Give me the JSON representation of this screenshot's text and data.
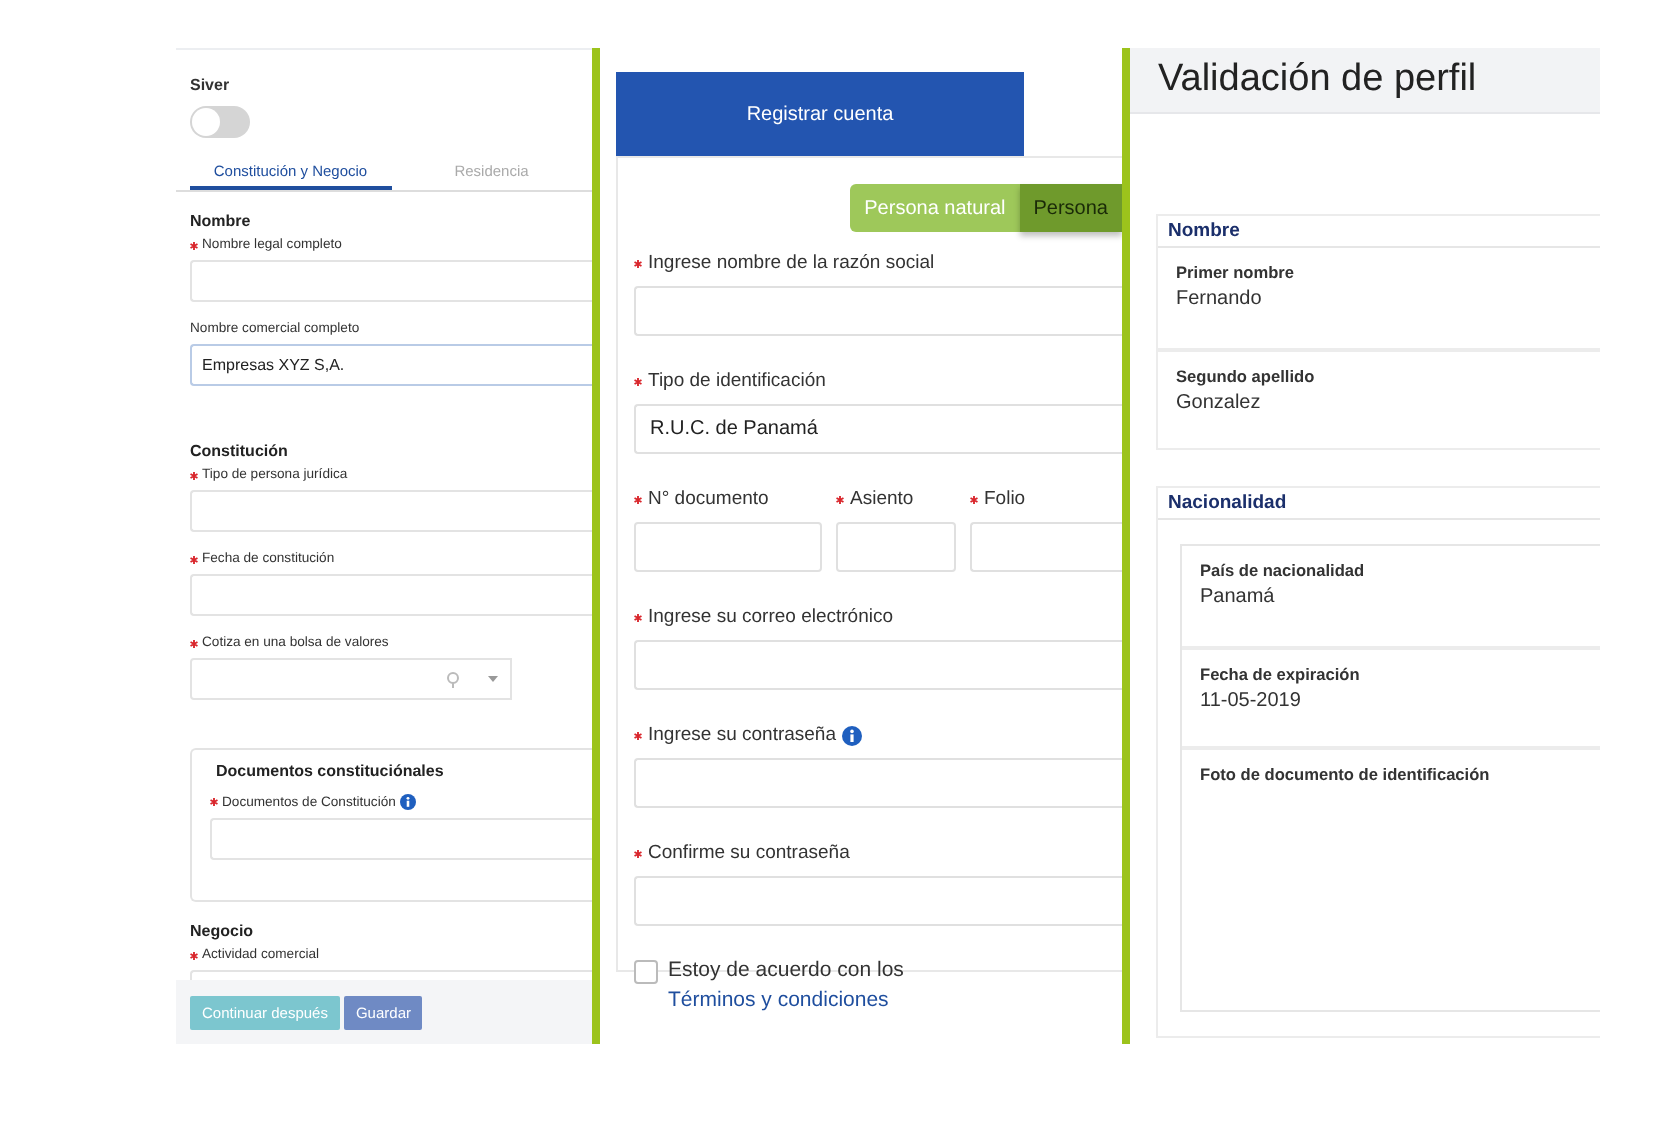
{
  "company_form": {
    "toggle": {
      "label": "Siver",
      "on": false
    },
    "tabs": [
      {
        "label": "Constitución y Negocio",
        "selected": true
      },
      {
        "label": "Residencia",
        "selected": false
      }
    ],
    "sections": [
      {
        "kind": "plain",
        "title": "Nombre",
        "fields": [
          {
            "kind": "text",
            "label": "Nombre legal completo",
            "required": true
          },
          {
            "kind": "text",
            "label": "Nombre comercial completo",
            "required": false,
            "value": "Empresas XYZ S,A."
          }
        ]
      },
      {
        "kind": "plain",
        "title": "Constitución",
        "fields": [
          {
            "kind": "text",
            "label": "Tipo de persona jurídica",
            "required": true
          },
          {
            "kind": "text",
            "label": "Fecha de constitución",
            "required": true
          },
          {
            "kind": "select",
            "label": "Cotiza en una bolsa de valores",
            "required": true
          }
        ]
      },
      {
        "kind": "fieldset",
        "title": "Documentos constituciónales",
        "fields": [
          {
            "kind": "text",
            "label": "Documentos de Constitución",
            "required": true,
            "info": true
          }
        ]
      },
      {
        "kind": "plain",
        "title": "Negocio",
        "fields": [
          {
            "kind": "text",
            "label": "Actividad comercial",
            "required": true
          }
        ]
      }
    ],
    "buttons": [
      {
        "label": "Continuar después",
        "kind": "secondary"
      },
      {
        "label": "Guardar",
        "kind": "primary"
      }
    ]
  },
  "register_form": {
    "title": "Registrar cuenta",
    "person_types": [
      {
        "label": "Persona natural",
        "selected": false
      },
      {
        "label": "Persona",
        "selected": true
      }
    ],
    "rows": [
      [
        {
          "label": "Ingrese nombre de la razón social",
          "required": true
        }
      ],
      [
        {
          "label": "Tipo de identificación",
          "required": true,
          "value": "R.U.C. de Panamá"
        }
      ],
      [
        {
          "label": "N° documento",
          "required": true
        },
        {
          "label": "Asiento",
          "required": true
        },
        {
          "label": "Folio",
          "required": true
        }
      ],
      [
        {
          "label": "Ingrese su correo electrónico",
          "required": true
        }
      ],
      [
        {
          "label": "Ingrese su contraseña",
          "required": true,
          "info": true
        }
      ],
      [
        {
          "label": "Confirme su contraseña",
          "required": true
        }
      ]
    ],
    "agreement": {
      "checked": false,
      "text": "Estoy de acuerdo con los",
      "link": "Términos y condiciones"
    }
  },
  "profile_validation": {
    "title": "Validación de perfil",
    "sections": [
      {
        "title": "Nombre",
        "inset": false,
        "rows": [
          {
            "kind": "text",
            "label": "Primer nombre",
            "value": "Fernando"
          },
          {
            "kind": "text",
            "label": "Segundo apellido",
            "value": "Gonzalez"
          }
        ]
      },
      {
        "title": "Nacionalidad",
        "inset": true,
        "rows": [
          {
            "kind": "text",
            "label": "País de nacionalidad",
            "value": "Panamá"
          },
          {
            "kind": "text",
            "label": "Fecha de expiración",
            "value": "11-05-2019"
          },
          {
            "kind": "photo",
            "label": "Foto de documento de identificación"
          }
        ]
      }
    ]
  }
}
